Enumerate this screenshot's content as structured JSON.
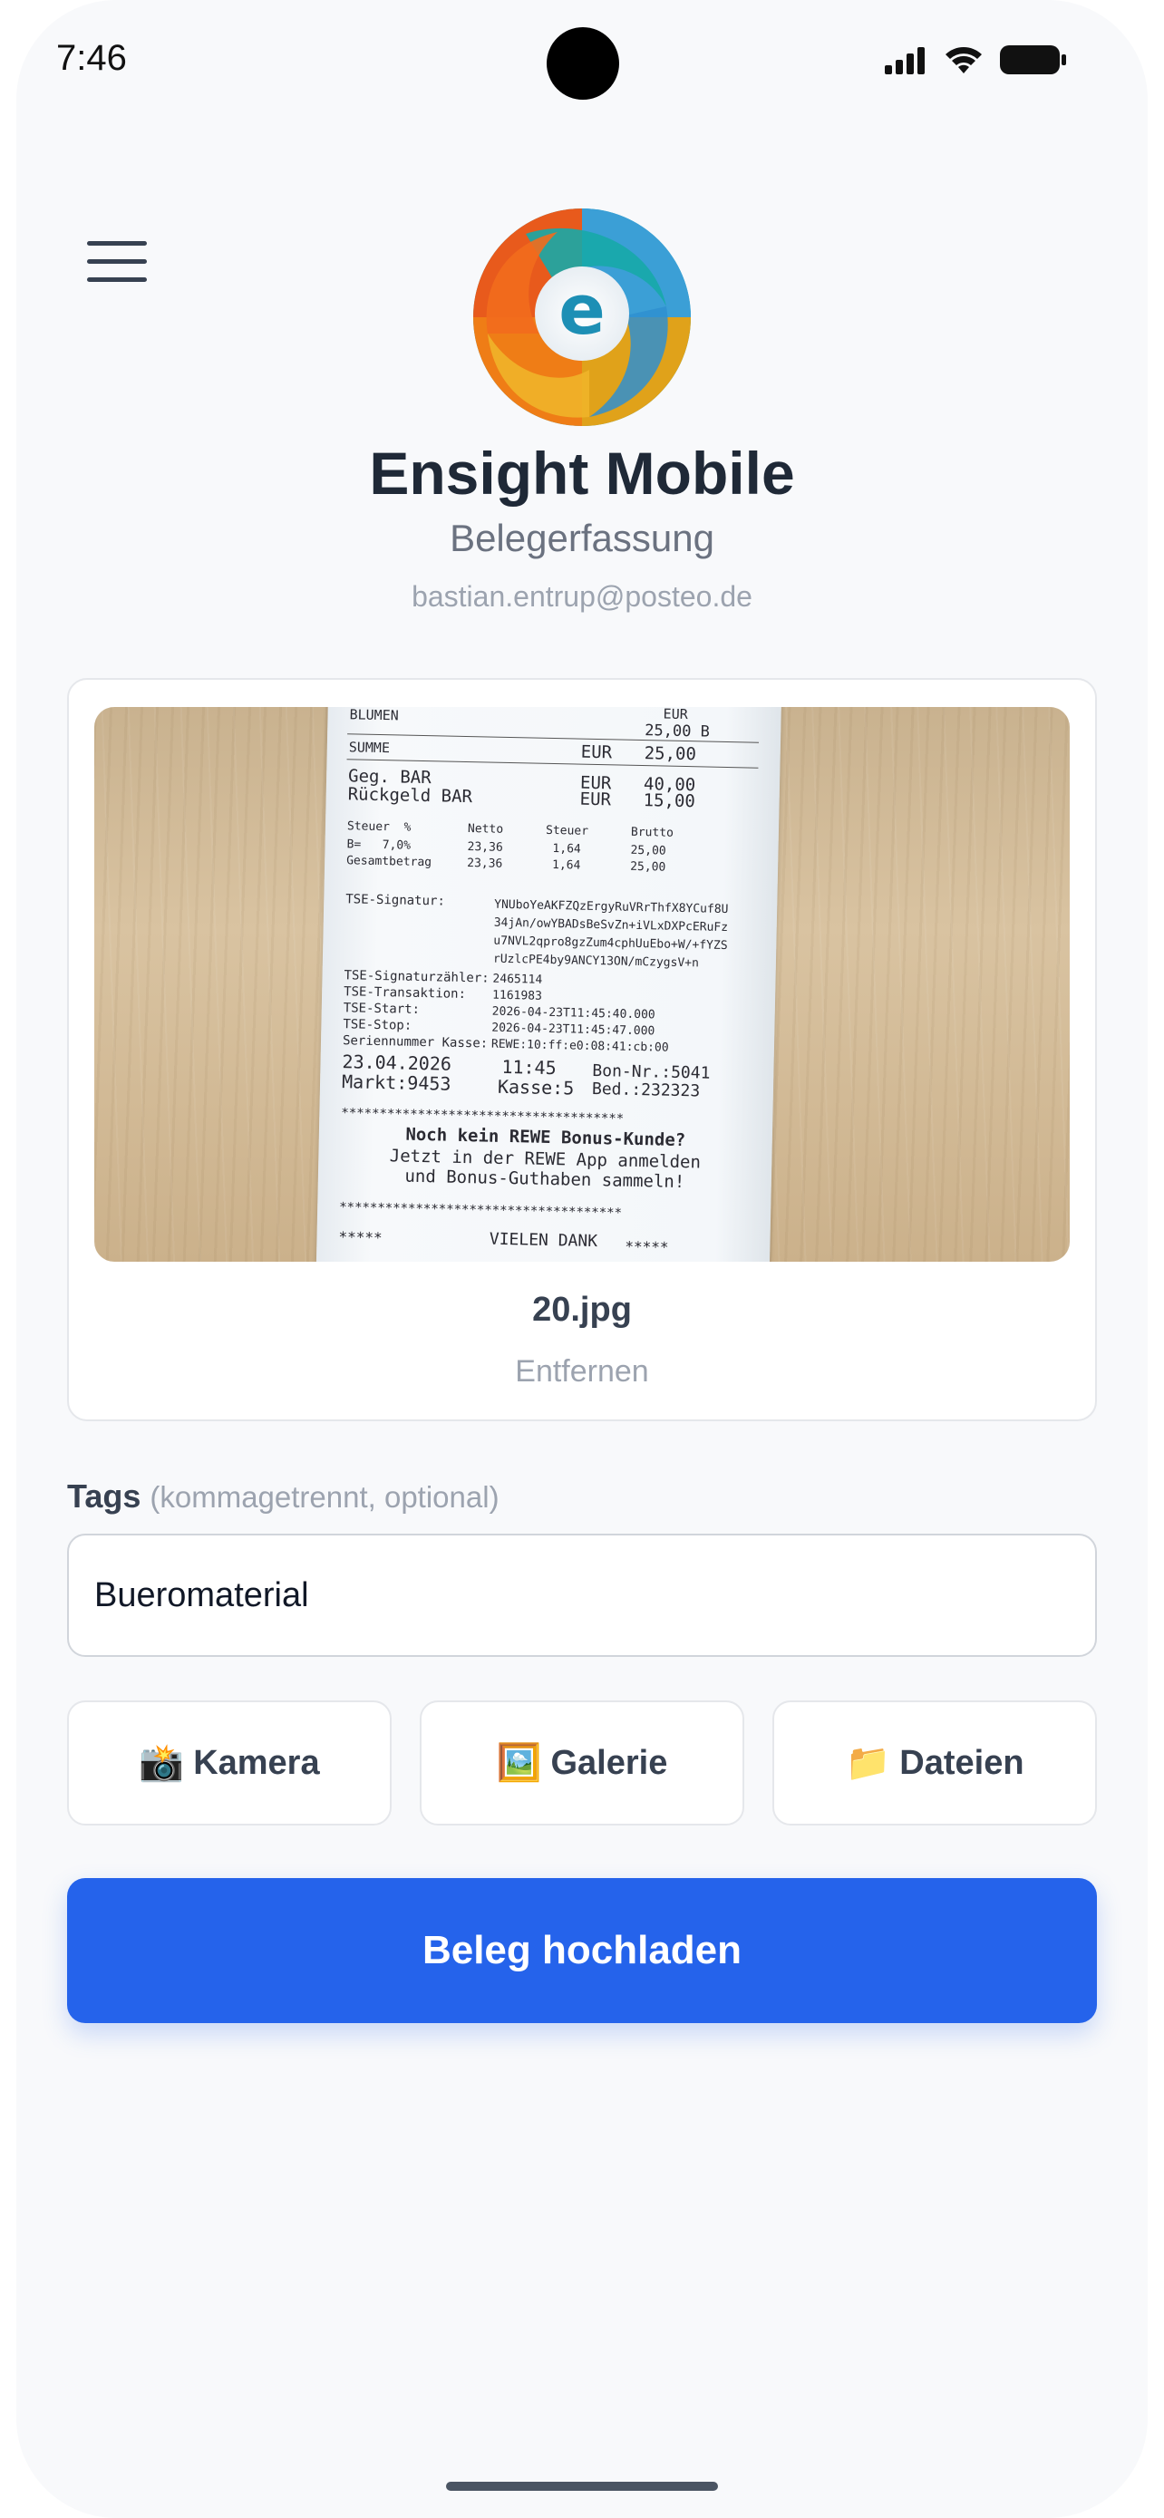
{
  "status_bar": {
    "time": "7:46"
  },
  "header": {
    "title": "Ensight Mobile",
    "subtitle": "Belegerfassung",
    "user_email": "bastian.entrup@posteo.de",
    "menu_icon": "hamburger-menu-icon",
    "logo_letter": "e"
  },
  "preview": {
    "file_name": "20.jpg",
    "remove_label": "Entfernen",
    "receipt": {
      "lines": [
        "BLUMEN",
        "SUMME",
        "Geg. BAR",
        "Rückgeld BAR",
        "Steuer  %        Netto      Steuer      Brutto",
        "B=   7,0%        23,36       1,64       25,00",
        "Gesamtbetrag     23,36       1,64       25,00",
        "TSE-Signatur:",
        "TSE-Signaturzähler:",
        "TSE-Transaktion:",
        "TSE-Start:",
        "TSE-Stop:",
        "Seriennummer Kasse:",
        "23.04.2026",
        "Markt:9453",
        "Noch kein REWE Bonus-Kunde?",
        "Jetzt in der REWE App anmelden",
        "und Bonus-Guthaben sammeln!",
        "VIELEN DANK"
      ],
      "values": {
        "blumen_cur": "EUR",
        "blumen_amount": "25,00 B",
        "summe_cur": "EUR",
        "summe_amount": "25,00",
        "bar_cur": "EUR",
        "bar_amount": "40,00",
        "rueck_cur": "EUR",
        "rueck_amount": "15,00",
        "signature": "YNUboYeAKFZQzErgyRuVRrThfX8YCuf8U",
        "sig2": "34jAn/owYBADsBeSvZn+iVLxDXPcERuFz",
        "sig3": "u7NVL2qpro8gzZum4cphUuEbo+W/+fYZS",
        "sig4": "rUzlcPE4by9ANCY13ON/mCzygsV+n",
        "sig_counter": "2465114",
        "transaction": "1161983",
        "start": "2026-04-23T11:45:40.000",
        "stop": "2026-04-23T11:45:47.000",
        "serial": "REWE:10:ff:e0:08:41:cb:00",
        "time": "11:45",
        "bon": "Bon-Nr.:5041",
        "kasse": "Kasse:5",
        "bed": "Bed.:232323",
        "stars_left": "*****",
        "stars_right": "*****",
        "stars_row": "*************************************"
      }
    }
  },
  "tags": {
    "label": "Tags",
    "hint": "(kommagetrennt, optional)",
    "value": "Bueromaterial",
    "placeholder": ""
  },
  "source_buttons": [
    {
      "icon": "📸",
      "icon_name": "camera-icon",
      "label": "Kamera"
    },
    {
      "icon": "🖼️",
      "icon_name": "picture-icon",
      "label": "Galerie"
    },
    {
      "icon": "📁",
      "icon_name": "folder-icon",
      "label": "Dateien"
    }
  ],
  "upload_button": {
    "label": "Beleg hochladen"
  },
  "colors": {
    "primary": "#2563eb",
    "background": "#f8f9fb",
    "title_text": "#1f2937",
    "muted_text": "#9ca3af"
  }
}
